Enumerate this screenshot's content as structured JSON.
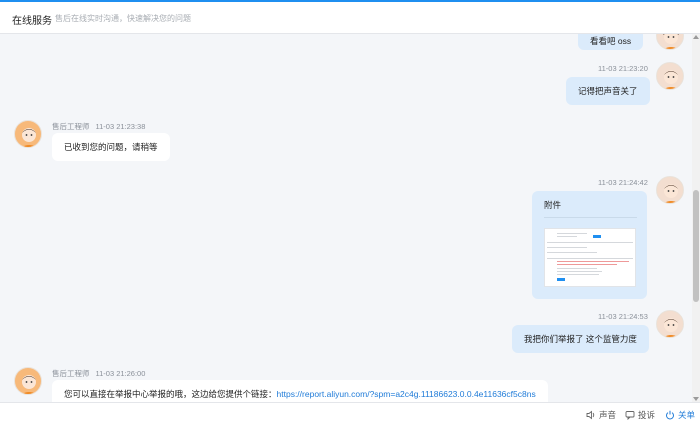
{
  "header": {
    "title": "在线服务",
    "subtitle": "售后在线实时沟通，快速解决您的问题"
  },
  "messages": [
    {
      "side": "user",
      "text": "看看吧  oss"
    },
    {
      "side": "user",
      "time": "11-03 21:23:20",
      "text": "记得把声音关了"
    },
    {
      "side": "agent",
      "name": "售后工程师",
      "time": "11-03 21:23:38",
      "text": "已收到您的问题，请稍等"
    },
    {
      "side": "user",
      "time": "11-03 21:24:42",
      "attachment_label": "附件"
    },
    {
      "side": "user",
      "time": "11-03 21:24:53",
      "text": "我把你们举报了  这个监管力度"
    },
    {
      "side": "agent",
      "name": "售后工程师",
      "time": "11-03 21:26:00",
      "text_prefix": "您可以直接在举报中心举报的哦，这边给您提供个链接：",
      "link": "https://report.aliyun.com/?spm=a2c4g.11186623.0.0.4e11636cf5c8ns"
    }
  ],
  "footer": {
    "sound_label": "声音",
    "complain_label": "投诉",
    "close_label": "关单"
  },
  "icons": {
    "sound": "speaker-icon",
    "complain": "comment-icon",
    "close": "power-icon"
  },
  "colors": {
    "accent": "#1f8ff0",
    "user_bubble": "#dbebfb",
    "link": "#1f7bd8"
  }
}
